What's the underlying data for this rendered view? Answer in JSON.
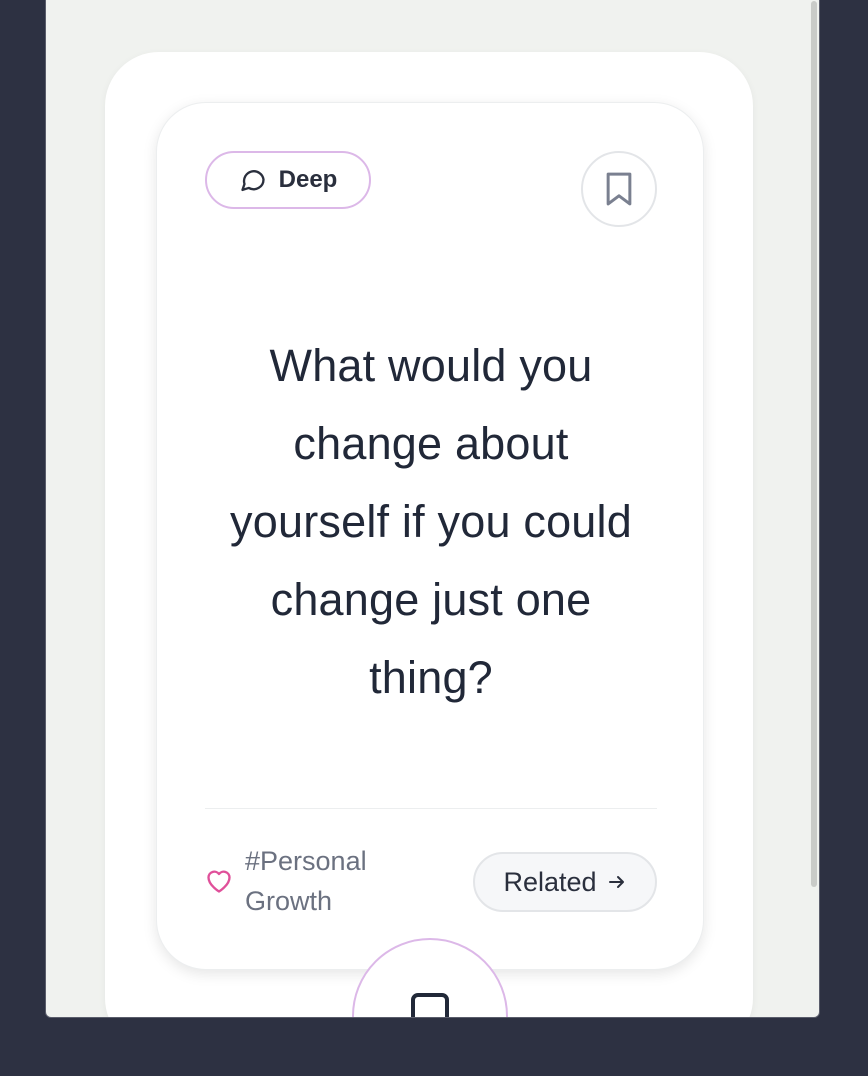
{
  "card": {
    "category_chip": {
      "label": "Deep",
      "icon": "speech-bubble-icon",
      "border_color": "#dcb8e8"
    },
    "bookmark": {
      "icon": "bookmark-icon"
    },
    "question": "What would you change about yourself if you could change just one thing?",
    "tag": {
      "icon": "heart-icon",
      "label": "#Personal Growth",
      "icon_color": "#e0509a"
    },
    "related_button": {
      "label": "Related",
      "icon": "arrow-right-icon"
    }
  },
  "fab": {
    "icon": "bookmark-icon"
  },
  "colors": {
    "page_background": "#2d3142",
    "frame_background": "#f0f2ef",
    "card_background": "#ffffff",
    "text_primary": "#212838",
    "text_muted": "#6b7180"
  }
}
